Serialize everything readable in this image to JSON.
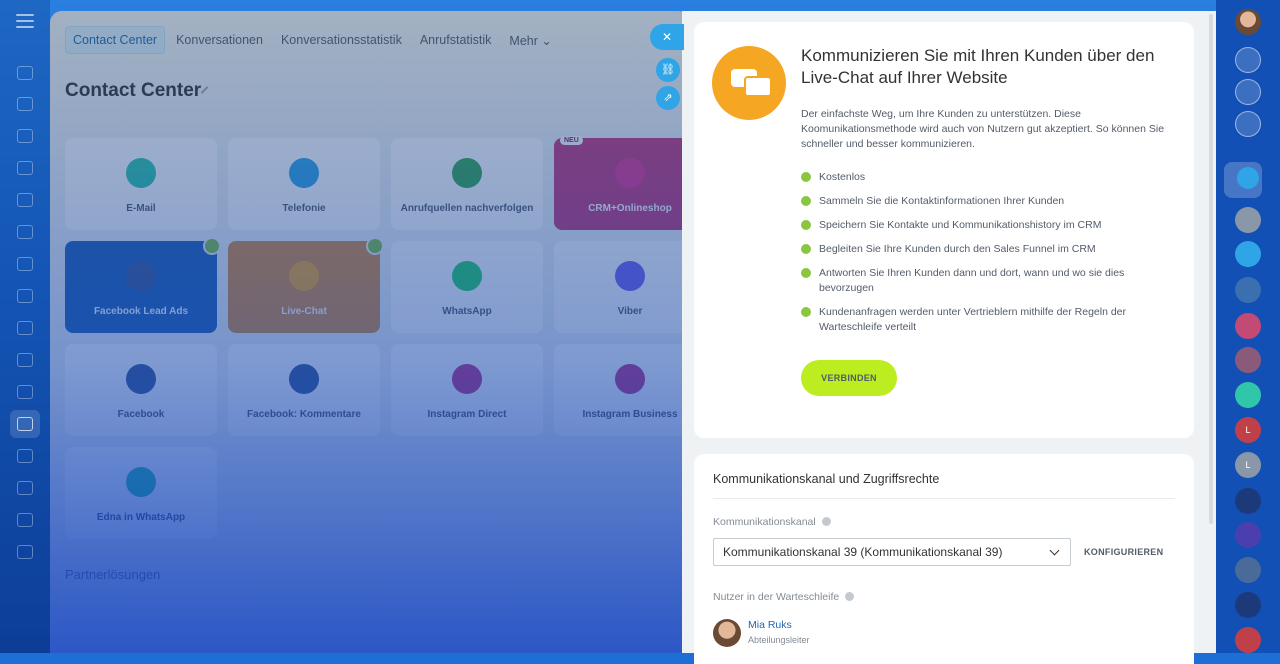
{
  "app": {
    "nav_tabs": [
      {
        "label": "Contact Center",
        "active": true
      },
      {
        "label": "Konversationen"
      },
      {
        "label": "Konversationsstatistik"
      },
      {
        "label": "Anrufstatistik"
      },
      {
        "label": "Mehr"
      }
    ],
    "page_title": "Contact Center",
    "tiles": [
      {
        "label": "E-Mail",
        "color": "#2fc6a9",
        "icon": "mail-icon"
      },
      {
        "label": "Telefonie",
        "color": "#2fa4e7",
        "icon": "phone-icon"
      },
      {
        "label": "Anrufquellen nachverfolgen",
        "color": "#34a853",
        "icon": "call-tracking-icon"
      },
      {
        "label": "CRM+Onlineshop",
        "color": "#e0338f",
        "icon": "store-icon",
        "badge": "NEU"
      },
      {
        "label": "Facebook Lead Ads",
        "color": "#3b5998",
        "icon": "form-icon",
        "checked": true
      },
      {
        "label": "Live-Chat",
        "color": "#f5a623",
        "icon": "chat-icon",
        "checked": true
      },
      {
        "label": "WhatsApp",
        "color": "#25d366",
        "icon": "whatsapp-icon"
      },
      {
        "label": "Viber",
        "color": "#7360f2",
        "icon": "viber-icon"
      },
      {
        "label": "Facebook",
        "color": "#3b5998",
        "icon": "facebook-icon"
      },
      {
        "label": "Facebook: Kommentare",
        "color": "#3b5998",
        "icon": "facebook-comment-icon"
      },
      {
        "label": "Instagram Direct",
        "color": "#c13584",
        "icon": "instagram-icon"
      },
      {
        "label": "Instagram Business",
        "color": "#c13584",
        "icon": "instagram-business-icon"
      },
      {
        "label": "Edna in WhatsApp",
        "color": "#2fc6a9",
        "icon": "edna-icon"
      }
    ],
    "partner_heading": "Partnerlösungen"
  },
  "panel": {
    "headline": "Kommunizieren Sie mit Ihren Kunden über den Live-Chat auf Ihrer Website",
    "description": "Der einfachste Weg, um Ihre Kunden zu unterstützen. Diese Koomunikationsmethode wird auch von Nutzern gut akzeptiert. So können Sie schneller und besser kommunizieren.",
    "features": [
      "Kostenlos",
      "Sammeln Sie die Kontaktinformationen Ihrer Kunden",
      "Speichern Sie Kontakte und Kommunikationshistory im CRM",
      "Begleiten Sie Ihre Kunden durch den Sales Funnel im CRM",
      "Antworten Sie Ihren Kunden dann und dort, wann und wo sie dies bevorzugen",
      "Kundenanfragen werden unter Vertrieblern mithilfe der Regeln der Warteschleife verteilt"
    ],
    "connect_button": "VERBINDEN",
    "section_heading": "Kommunikationskanal und Zugriffsrechte",
    "channel_label": "Kommunikationskanal",
    "channel_value": "Kommunikationskanal 39 (Kommunikationskanal 39)",
    "configure_button": "KONFIGURIEREN",
    "queue_label": "Nutzer in der Warteschleife",
    "queue_user": {
      "name": "Mia Ruks",
      "role": "Abteilungsleiter"
    }
  },
  "right_rail": {
    "letters": [
      "L",
      "L"
    ]
  },
  "colors": {
    "accent": "#2fa4e7",
    "connect_green": "#bbed21",
    "check_green": "#8cc63f",
    "livechat_orange": "#f5a623"
  }
}
